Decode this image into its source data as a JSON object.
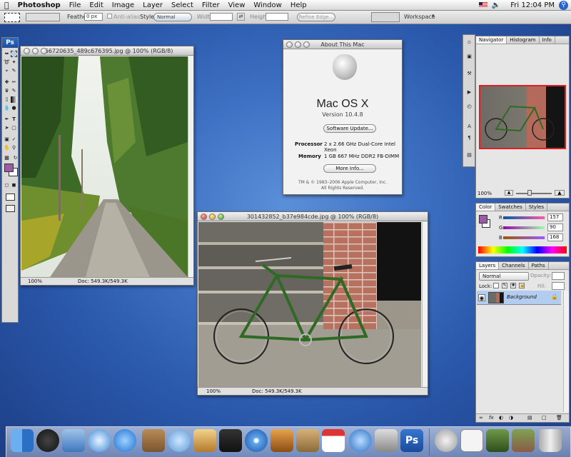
{
  "menubar": {
    "apple_icon": "apple-icon",
    "app_name": "Photoshop",
    "menus": [
      "File",
      "Edit",
      "Image",
      "Layer",
      "Select",
      "Filter",
      "View",
      "Window",
      "Help"
    ],
    "clock": "Fri 12:04 PM"
  },
  "options_bar": {
    "feather_label": "Feather:",
    "feather_value": "0 px",
    "anti_alias": "Anti-alias",
    "style_label": "Style:",
    "style_value": "Normal",
    "width_label": "Width:",
    "height_label": "Height:",
    "refine_edge": "Refine Edge...",
    "workspace": "Workspace"
  },
  "toolbox": {
    "logo": "Ps"
  },
  "forest_window": {
    "title": "266720635_489c676395.jpg @ 100% (RGB/8)",
    "zoom": "100%",
    "doc": "Doc: 549.3K/549.3K"
  },
  "bike_window": {
    "title": "301432852_b37e984cde.jpg @ 100% (RGB/8)",
    "zoom": "100%",
    "doc": "Doc: 549.3K/549.3K"
  },
  "about_window": {
    "title": "About This Mac",
    "os_name": "Mac OS X",
    "version": "Version 10.4.8",
    "software_update": "Software Update...",
    "processor_label": "Processor",
    "processor_value": "2 x 2.66 GHz Dual-Core Intel Xeon",
    "memory_label": "Memory",
    "memory_value": "1 GB 667 MHz DDR2 FB-DIMM",
    "more_info": "More Info...",
    "copyright_1": "TM & © 1983–2006 Apple Computer, Inc.",
    "copyright_2": "All Rights Reserved."
  },
  "navigator_panel": {
    "tabs": [
      "Navigator",
      "Histogram",
      "Info"
    ],
    "zoom": "100%"
  },
  "color_panel": {
    "tabs": [
      "Color",
      "Swatches",
      "Styles"
    ],
    "r_label": "R",
    "r_value": "157",
    "g_label": "G",
    "g_value": "90",
    "b_label": "B",
    "b_value": "168",
    "foreground": "#9d5aa8"
  },
  "layers_panel": {
    "tabs": [
      "Layers",
      "Channels",
      "Paths"
    ],
    "blend_mode": "Normal",
    "opacity_label": "Opacity:",
    "lock_label": "Lock:",
    "fill_label": "Fill:",
    "layer_name": "Background"
  }
}
